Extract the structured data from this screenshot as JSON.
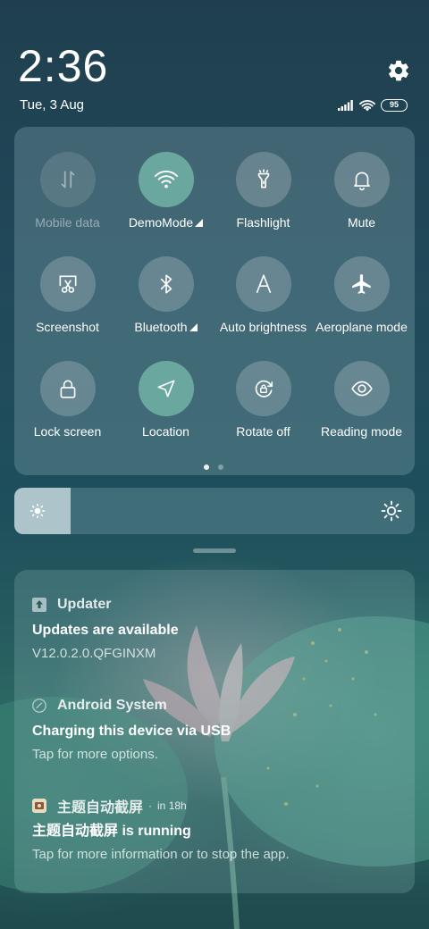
{
  "status": {
    "time": "2:36",
    "date": "Tue, 3 Aug",
    "battery_level": "95",
    "settings_icon": "gear-icon",
    "signal_icon": "signal-bars-icon",
    "wifi_icon": "wifi-icon"
  },
  "quick_settings": {
    "tiles": [
      {
        "label": "Mobile data",
        "icon": "mobile-data-icon",
        "state": "disabled"
      },
      {
        "label": "DemoMode",
        "icon": "wifi-icon",
        "state": "active",
        "has_submenu": true
      },
      {
        "label": "Flashlight",
        "icon": "flashlight-icon",
        "state": "off"
      },
      {
        "label": "Mute",
        "icon": "bell-icon",
        "state": "off"
      },
      {
        "label": "Screenshot",
        "icon": "screenshot-icon",
        "state": "off"
      },
      {
        "label": "Bluetooth",
        "icon": "bluetooth-icon",
        "state": "off",
        "has_submenu": true
      },
      {
        "label": "Auto brightness",
        "icon": "auto-brightness-icon",
        "state": "off"
      },
      {
        "label": "Aeroplane mode",
        "icon": "airplane-icon",
        "state": "off"
      },
      {
        "label": "Lock screen",
        "icon": "lock-icon",
        "state": "off"
      },
      {
        "label": "Location",
        "icon": "location-arrow-icon",
        "state": "active"
      },
      {
        "label": "Rotate off",
        "icon": "rotate-lock-icon",
        "state": "off"
      },
      {
        "label": "Reading mode",
        "icon": "eye-icon",
        "state": "off"
      }
    ],
    "pages": 2,
    "current_page": 1
  },
  "brightness": {
    "level_fraction": 0.14,
    "low_icon": "sun-small-icon",
    "high_icon": "sun-large-icon"
  },
  "notifications": [
    {
      "app": "Updater",
      "time": "",
      "title": "Updates are available",
      "text": "V12.0.2.0.QFGINXM",
      "icon": "updater-icon"
    },
    {
      "app": "Android System",
      "time": "",
      "title": "Charging this device via USB",
      "text": "Tap for more options.",
      "icon": "android-system-icon"
    },
    {
      "app": "主题自动截屏",
      "time": "in 18h",
      "title": "主题自动截屏 is running",
      "text": "Tap for more information or to stop the app.",
      "icon": "theme-screenshot-app-icon"
    }
  ],
  "colors": {
    "active_tile": "#6aa89f",
    "panel": "rgba(150,185,195,0.28)"
  }
}
